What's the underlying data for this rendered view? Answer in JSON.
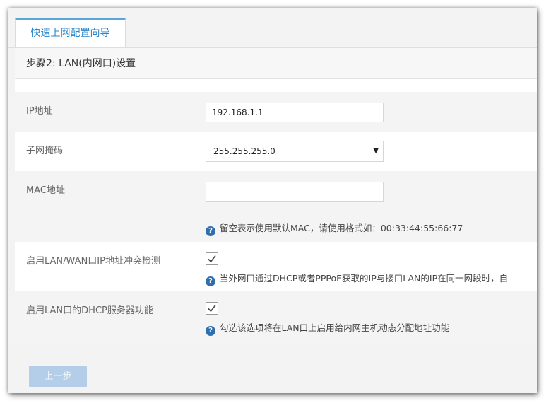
{
  "tab": {
    "label": "快速上网配置向导"
  },
  "step": {
    "title": "步骤2: LAN(内网口)设置"
  },
  "form": {
    "ip": {
      "label": "IP地址",
      "value": "192.168.1.1"
    },
    "mask": {
      "label": "子网掩码",
      "value": "255.255.255.0"
    },
    "mac": {
      "label": "MAC地址",
      "value": "",
      "hint": "留空表示使用默认MAC，请使用格式如：00:33:44:55:66:77"
    },
    "conflict": {
      "label": "启用LAN/WAN口IP地址冲突检测",
      "checked": true,
      "hint": "当外网口通过DHCP或者PPPoE获取的IP与接口LAN的IP在同一网段时，自"
    },
    "dhcp": {
      "label": "启用LAN口的DHCP服务器功能",
      "checked": true,
      "hint": "勾选该选项将在LAN口上启用给内网主机动态分配地址功能"
    }
  },
  "buttons": {
    "prev": "上一步"
  },
  "icons": {
    "help": "help-circle-icon",
    "caret": "caret-down-icon",
    "check": "checkmark-icon"
  },
  "colors": {
    "accent": "#2a85c8",
    "tab_border": "#5aa5d8",
    "help_icon": "#2f6fb0",
    "button_disabled": "#b4cde8"
  }
}
